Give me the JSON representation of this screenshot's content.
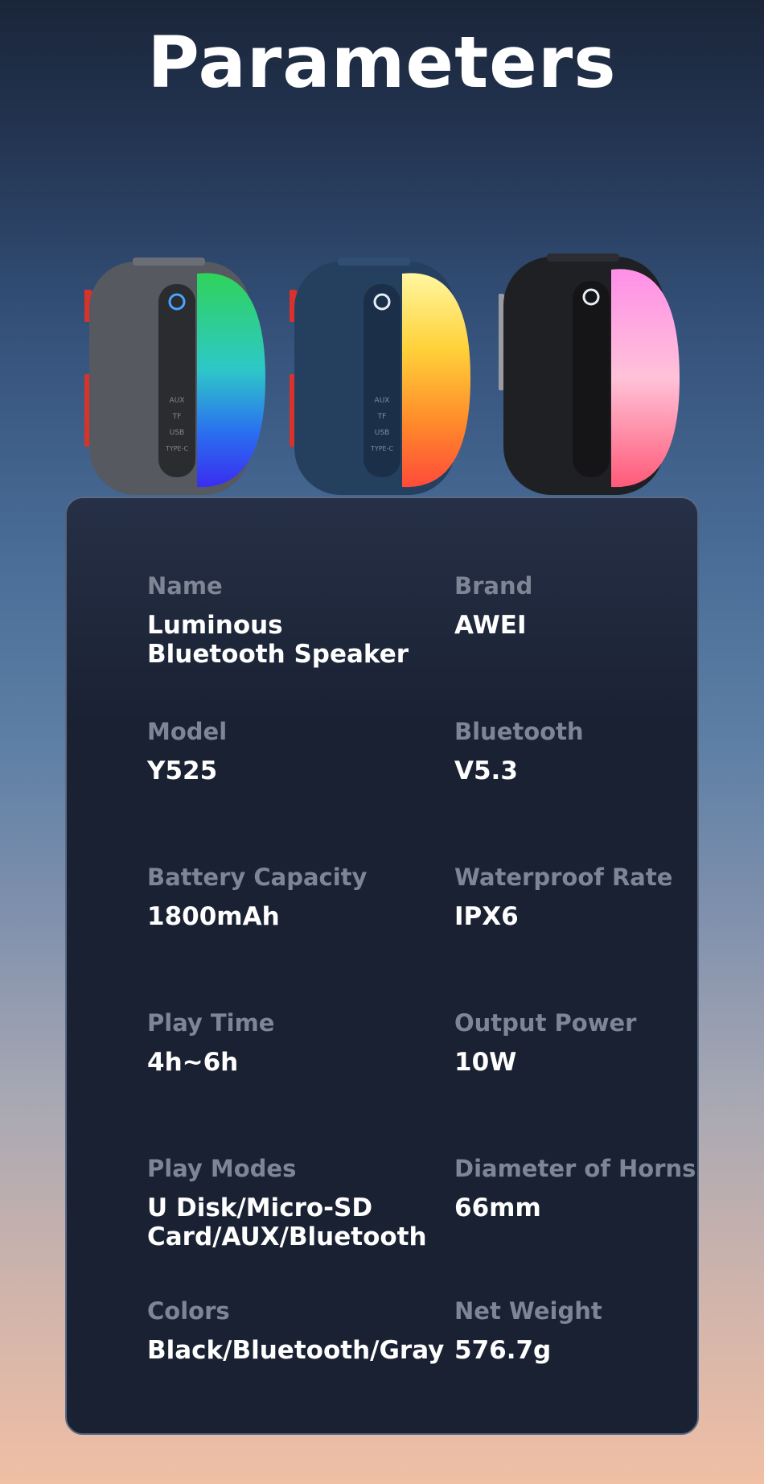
{
  "page": {
    "title": "Parameters"
  },
  "speakers": [
    {
      "color": "gray",
      "body": "#56595f",
      "light_top": "#2fd35a",
      "light_bottom": "#2a2df0",
      "panel_labels": [
        "AUX",
        "TF",
        "USB",
        "TYPE-C"
      ]
    },
    {
      "color": "blue",
      "body": "#25405f",
      "light_top": "#ffe95a",
      "light_bottom": "#ff4b3a",
      "panel_labels": [
        "AUX",
        "TF",
        "USB",
        "TYPE-C"
      ]
    },
    {
      "color": "black",
      "body": "#1f2024",
      "light_top": "#ff7fe0",
      "light_bottom": "#ff4f7a",
      "panel_labels": []
    }
  ],
  "specs": [
    {
      "label": "Name",
      "value": "Luminous Bluetooth Speaker"
    },
    {
      "label": "Brand",
      "value": "AWEI"
    },
    {
      "label": "Model",
      "value": "Y525"
    },
    {
      "label": "Bluetooth",
      "value": "V5.3"
    },
    {
      "label": "Battery Capacity",
      "value": "1800mAh"
    },
    {
      "label": "Waterproof Rate",
      "value": "IPX6"
    },
    {
      "label": "Play Time",
      "value": "4h~6h"
    },
    {
      "label": "Output Power",
      "value": "10W"
    },
    {
      "label": "Play Modes",
      "value": "U Disk/Micro-SD Card/AUX/Bluetooth"
    },
    {
      "label": "Diameter of Horns",
      "value": "66mm"
    },
    {
      "label": "Colors",
      "value": "Black/Bluetooth/Gray"
    },
    {
      "label": "Net Weight",
      "value": "576.7g"
    }
  ]
}
